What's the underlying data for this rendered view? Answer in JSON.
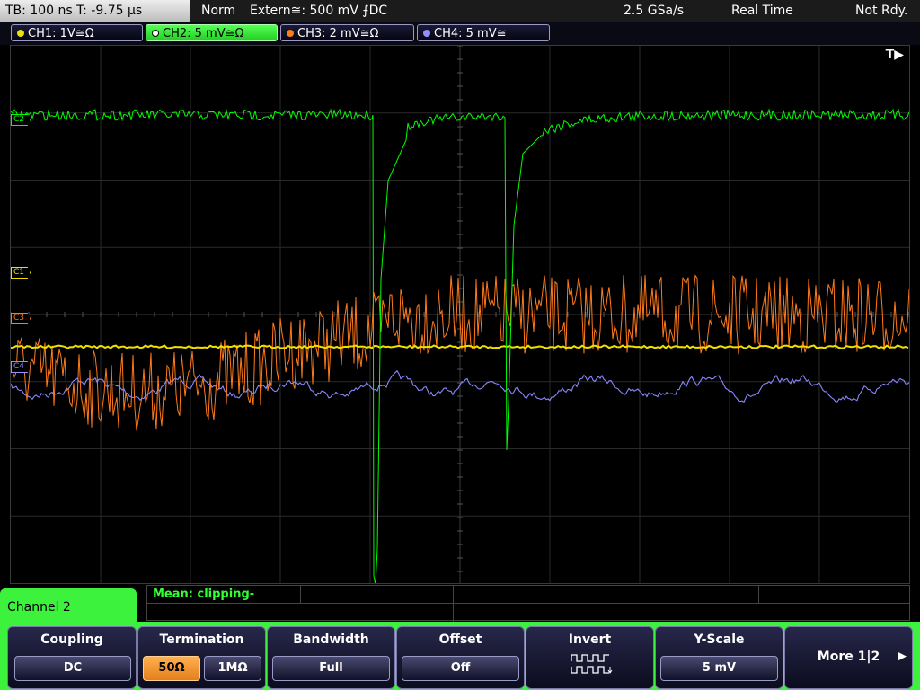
{
  "status": {
    "timebase": "TB: 100 ns   T: -9.75 µs",
    "mode": "Norm",
    "trigger": "Extern≅: 500 mV ⨍DC",
    "sample_rate": "2.5 GSa/s",
    "acq_mode": "Real Time",
    "state": "Not Rdy."
  },
  "channels": [
    {
      "label": "CH1: 1V≅Ω",
      "color": "#f0e000"
    },
    {
      "label": "CH2: 5 mV≅Ω",
      "color": "#00ff00"
    },
    {
      "label": "CH3: 2 mV≅Ω",
      "color": "#ff7a1a"
    },
    {
      "label": "CH4: 5 mV≅",
      "color": "#9090ff"
    }
  ],
  "screen": {
    "trigger_marker": "T▶",
    "markers": [
      "C1",
      "C2",
      "C3",
      "C4"
    ]
  },
  "measurement": {
    "text": "Mean: clipping-"
  },
  "menu": {
    "title": "Channel 2",
    "coupling": {
      "title": "Coupling",
      "value": "DC"
    },
    "termination": {
      "title": "Termination",
      "options": [
        "50Ω",
        "1MΩ"
      ],
      "selected": "50Ω"
    },
    "bandwidth": {
      "title": "Bandwidth",
      "value": "Full"
    },
    "offset": {
      "title": "Offset",
      "value": "Off"
    },
    "invert": {
      "title": "Invert"
    },
    "yscale": {
      "title": "Y-Scale",
      "value": "5 mV"
    },
    "more": {
      "label": "More 1|2"
    }
  }
}
